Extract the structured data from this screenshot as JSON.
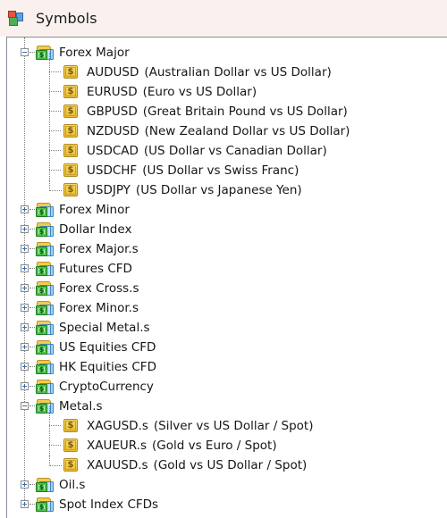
{
  "header": {
    "title": "Symbols",
    "icon": "symbols-window-icon"
  },
  "tree": {
    "expander_expanded": "−",
    "expander_collapsed": "+",
    "folder_icon": "symbol-group-folder-icon",
    "symbol_icon": "currency-symbol-icon",
    "nodes": [
      {
        "label": "Forex Major",
        "state": "expanded",
        "children": [
          {
            "code": "AUDUSD",
            "desc": "(Australian Dollar vs US Dollar)"
          },
          {
            "code": "EURUSD",
            "desc": "(Euro vs US Dollar)"
          },
          {
            "code": "GBPUSD",
            "desc": "(Great Britain Pound vs US Dollar)"
          },
          {
            "code": "NZDUSD",
            "desc": "(New Zealand Dollar vs US Dollar)"
          },
          {
            "code": "USDCAD",
            "desc": "(US Dollar vs Canadian Dollar)"
          },
          {
            "code": "USDCHF",
            "desc": "(US Dollar vs Swiss Franc)"
          },
          {
            "code": "USDJPY",
            "desc": "(US Dollar vs Japanese Yen)"
          }
        ]
      },
      {
        "label": "Forex Minor",
        "state": "collapsed",
        "children": []
      },
      {
        "label": "Dollar Index",
        "state": "collapsed",
        "children": []
      },
      {
        "label": "Forex Major.s",
        "state": "collapsed",
        "children": []
      },
      {
        "label": "Futures CFD",
        "state": "collapsed",
        "children": []
      },
      {
        "label": "Forex Cross.s",
        "state": "collapsed",
        "children": []
      },
      {
        "label": "Forex Minor.s",
        "state": "collapsed",
        "children": []
      },
      {
        "label": "Special Metal.s",
        "state": "collapsed",
        "children": []
      },
      {
        "label": "US Equities CFD",
        "state": "collapsed",
        "children": []
      },
      {
        "label": "HK Equities CFD",
        "state": "collapsed",
        "children": []
      },
      {
        "label": "CryptoCurrency",
        "state": "collapsed",
        "children": []
      },
      {
        "label": "Metal.s",
        "state": "expanded",
        "children": [
          {
            "code": "XAGUSD.s",
            "desc": "(Silver vs US Dollar / Spot)"
          },
          {
            "code": "XAUEUR.s",
            "desc": "(Gold vs Euro / Spot)"
          },
          {
            "code": "XAUUSD.s",
            "desc": "(Gold vs US Dollar / Spot)"
          }
        ]
      },
      {
        "label": "Oil.s",
        "state": "collapsed",
        "children": []
      },
      {
        "label": "Spot Index CFDs",
        "state": "collapsed",
        "children": []
      }
    ]
  }
}
